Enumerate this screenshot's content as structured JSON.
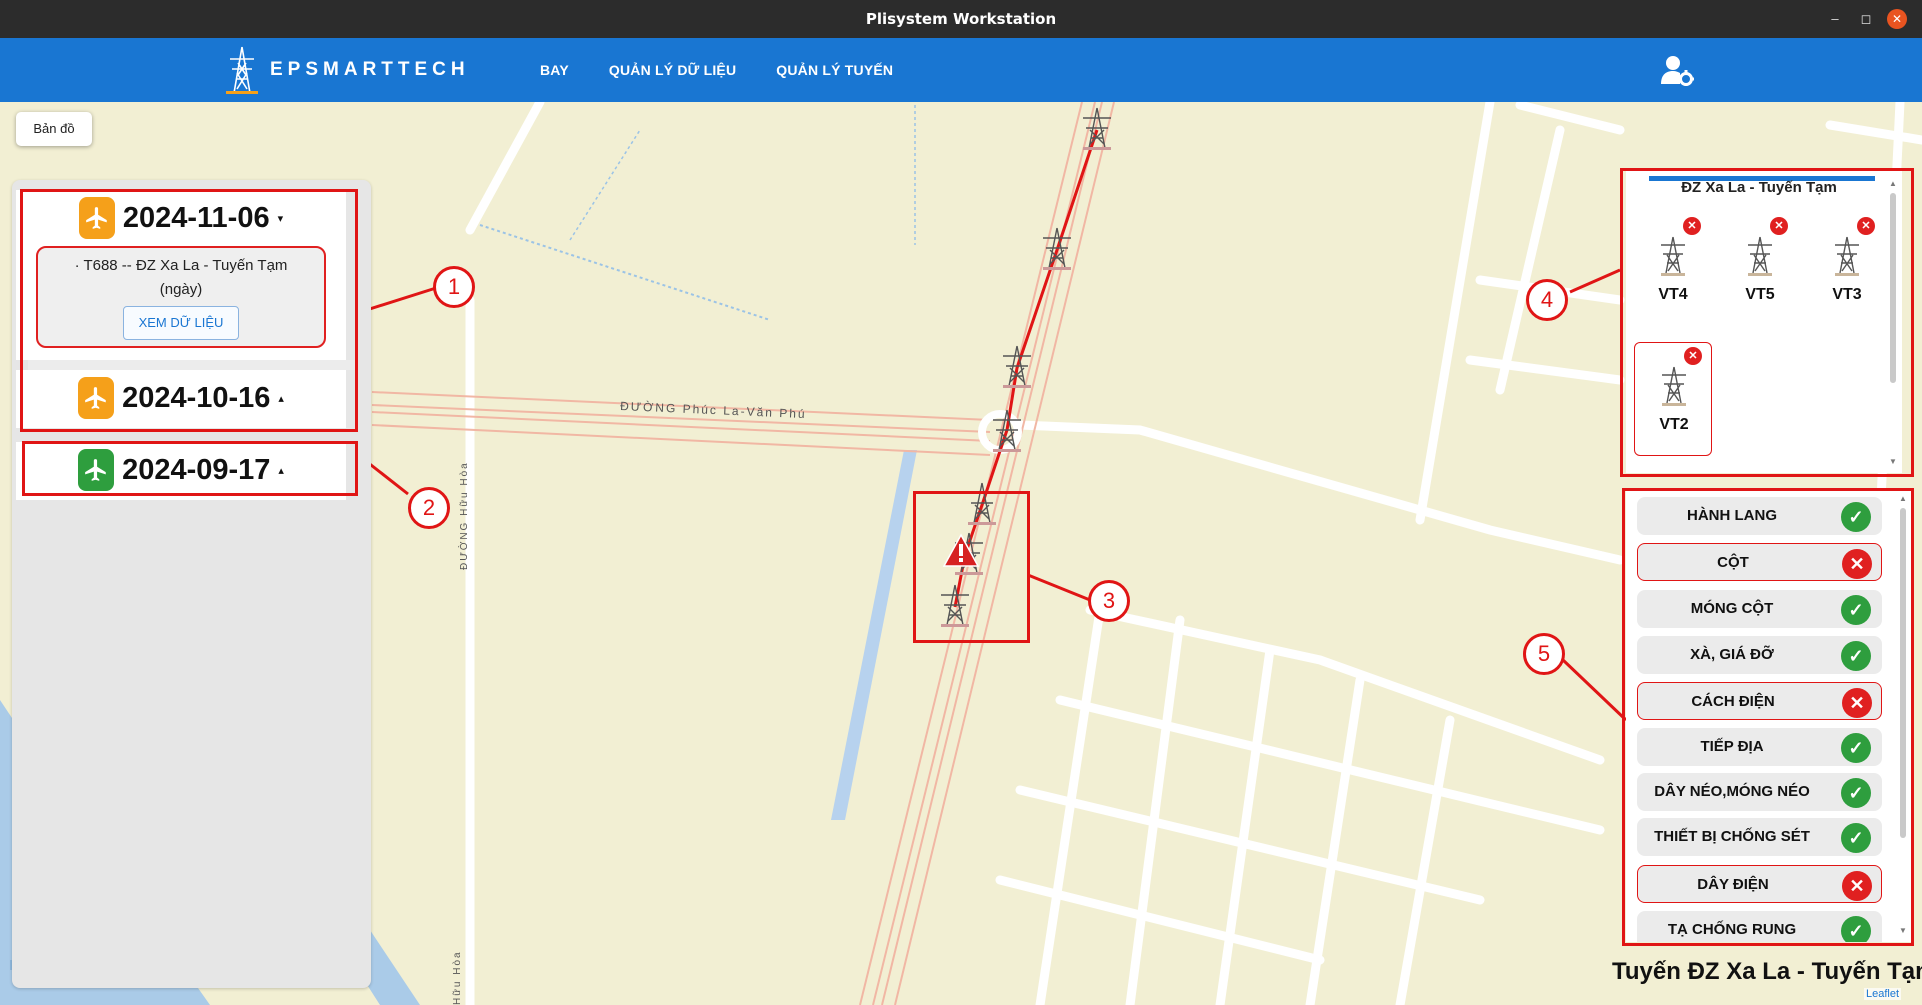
{
  "window": {
    "title": "Plisystem Workstation",
    "minimize": "–",
    "maximize": "◻",
    "close": "✕"
  },
  "header": {
    "brand": "EPSMARTTECH",
    "nav": [
      "BAY",
      "QUẢN LÝ DỮ LIỆU",
      "QUẢN LÝ TUYẾN"
    ],
    "user_icon": "user-gear-icon",
    "background": "#1976d2"
  },
  "map": {
    "button": "Bản đồ",
    "road_main": "ĐƯỜNG Phúc La-Văn Phú",
    "road_side": "ĐƯỜNG Hữu Hòa",
    "road_side_bottom": "Hữu Hòa",
    "attribution": "Leaflet",
    "route_color": "#e01515"
  },
  "flights": [
    {
      "date": "2024-11-06",
      "badge_color": "#f5a01a",
      "caret": "▾",
      "expanded": true,
      "detail_line1": "· T688 -- ĐZ Xa La - Tuyến Tạm",
      "detail_line2": "(ngày)",
      "button": "XEM DỮ LIỆU"
    },
    {
      "date": "2024-10-16",
      "badge_color": "#f5a01a",
      "caret": "▴",
      "expanded": false
    },
    {
      "date": "2024-09-17",
      "badge_color": "#2e9e3e",
      "caret": "▴",
      "expanded": false
    }
  ],
  "callouts": [
    "1",
    "2",
    "3",
    "4",
    "5"
  ],
  "tower_panel": {
    "route": "ĐZ Xa La - Tuyến Tạm",
    "towers": [
      "VT4",
      "VT5",
      "VT3",
      "VT2"
    ],
    "selected": "VT2"
  },
  "checks": [
    {
      "name": "HÀNH LANG",
      "status": "ok"
    },
    {
      "name": "CỘT",
      "status": "fail"
    },
    {
      "name": "MÓNG CỘT",
      "status": "ok"
    },
    {
      "name": "XÀ, GIÁ ĐỠ",
      "status": "ok"
    },
    {
      "name": "CÁCH ĐIỆN",
      "status": "fail"
    },
    {
      "name": "TIẾP ĐỊA",
      "status": "ok"
    },
    {
      "name": "DÂY NÉO,MÓNG NÉO",
      "status": "ok"
    },
    {
      "name": "THIẾT BỊ CHỐNG SÉT",
      "status": "ok"
    },
    {
      "name": "DÂY ĐIỆN",
      "status": "fail"
    },
    {
      "name": "TẠ CHỐNG RUNG",
      "status": "ok"
    }
  ],
  "footer": {
    "route": "Tuyến ĐZ Xa La - Tuyến Tạm"
  }
}
